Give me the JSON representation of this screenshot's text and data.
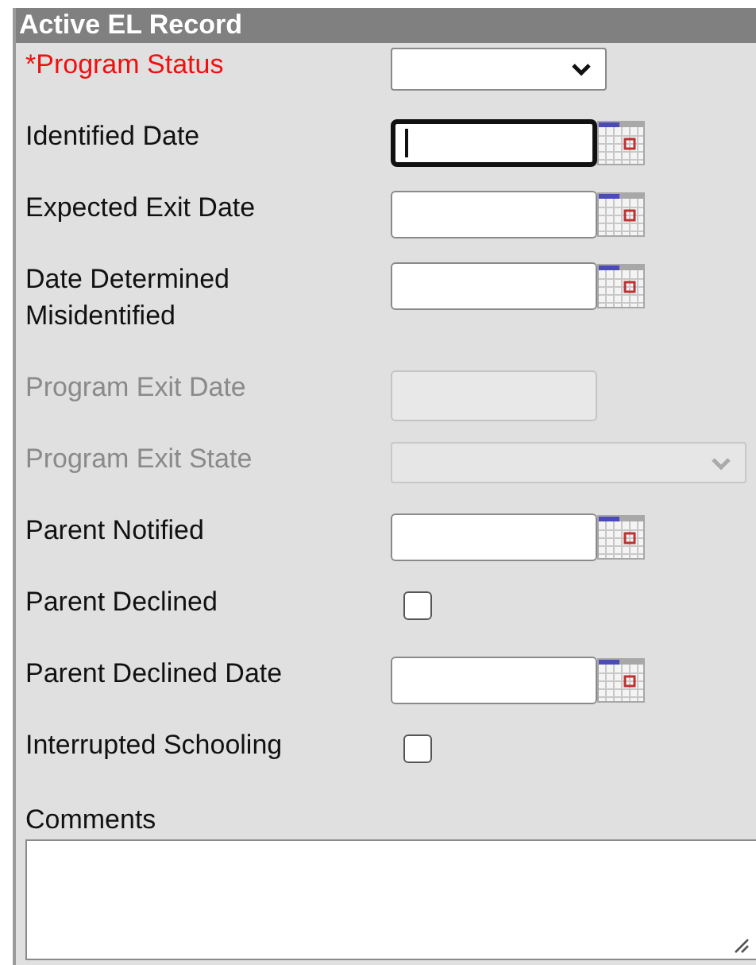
{
  "panel": {
    "title": "Active EL Record"
  },
  "fields": [
    {
      "label": "*Program Status",
      "kind": "select",
      "required": true,
      "disabled": false,
      "focused": false
    },
    {
      "label": "Identified Date",
      "kind": "date",
      "required": false,
      "disabled": false,
      "focused": true
    },
    {
      "label": "Expected Exit Date",
      "kind": "date",
      "required": false,
      "disabled": false,
      "focused": false
    },
    {
      "label": "Date Determined Misidentified",
      "kind": "date",
      "required": false,
      "disabled": false,
      "focused": false
    },
    {
      "label": "Program Exit Date",
      "kind": "text",
      "required": false,
      "disabled": true,
      "focused": false
    },
    {
      "label": "Program Exit State",
      "kind": "select",
      "required": false,
      "disabled": true,
      "focused": false
    },
    {
      "label": "Parent Notified",
      "kind": "date",
      "required": false,
      "disabled": false,
      "focused": false
    },
    {
      "label": "Parent Declined",
      "kind": "checkbox",
      "required": false,
      "disabled": false,
      "focused": false,
      "checked": false
    },
    {
      "label": "Parent Declined Date",
      "kind": "date",
      "required": false,
      "disabled": false,
      "focused": false
    },
    {
      "label": "Interrupted Schooling",
      "kind": "checkbox",
      "required": false,
      "disabled": false,
      "focused": false,
      "checked": false
    }
  ],
  "comments": {
    "label": "Comments"
  }
}
